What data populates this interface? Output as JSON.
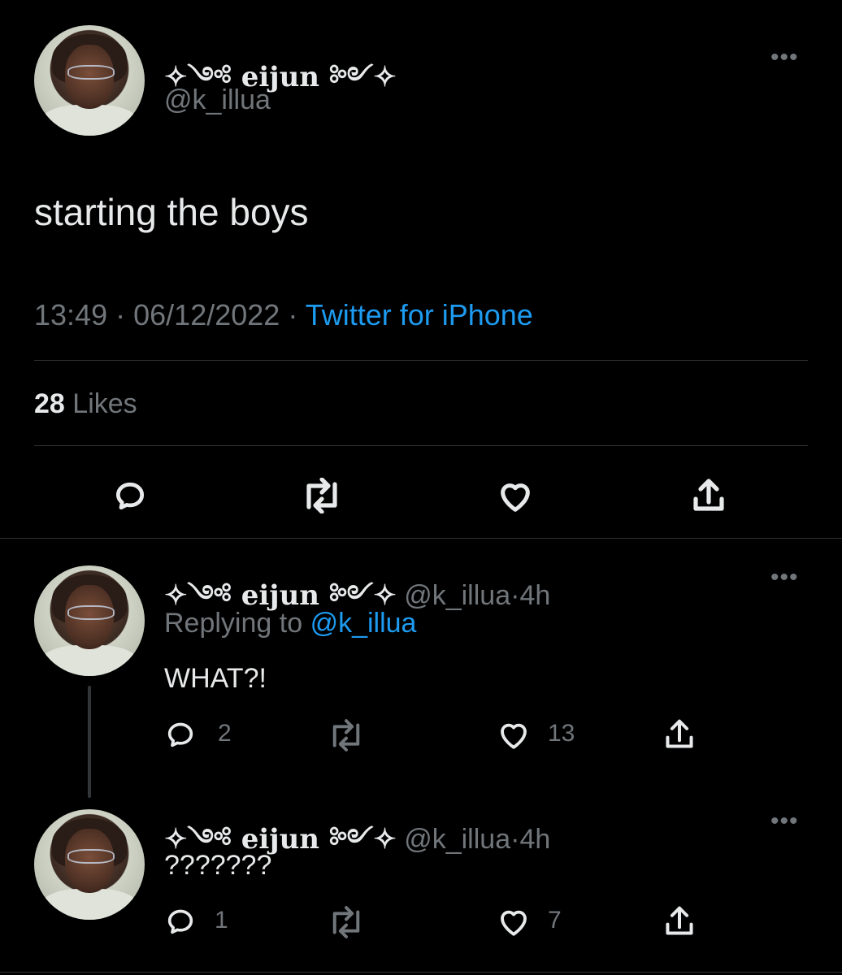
{
  "main_tweet": {
    "display_name": "✧༺ eijun ༻✧",
    "handle": "@k_illua",
    "text": "starting the boys",
    "time": "13:49",
    "separator": "·",
    "date": "06/12/2022",
    "source": "Twitter for iPhone",
    "likes_count": "28",
    "likes_label": "Likes"
  },
  "replies": [
    {
      "display_name": "✧༺ eijun ༻✧",
      "handle": "@k_illua",
      "dot": "·",
      "age": "4h",
      "replying_prefix": "Replying to",
      "replying_handle": "@k_illua",
      "text": "WHAT?!",
      "reply_count": "2",
      "like_count": "13"
    },
    {
      "display_name": "✧༺ eijun ༻✧",
      "handle": "@k_illua",
      "dot": "·",
      "age": "4h",
      "text": "???????",
      "reply_count": "1",
      "like_count": "7"
    }
  ],
  "icons": {
    "more": "more-icon",
    "reply": "reply-icon",
    "retweet": "retweet-icon",
    "like": "heart-icon",
    "share": "share-icon"
  },
  "colors": {
    "background": "#000000",
    "text": "#e7e9ea",
    "muted": "#71767b",
    "accent": "#1d9bf0",
    "divider": "#2f3336"
  }
}
